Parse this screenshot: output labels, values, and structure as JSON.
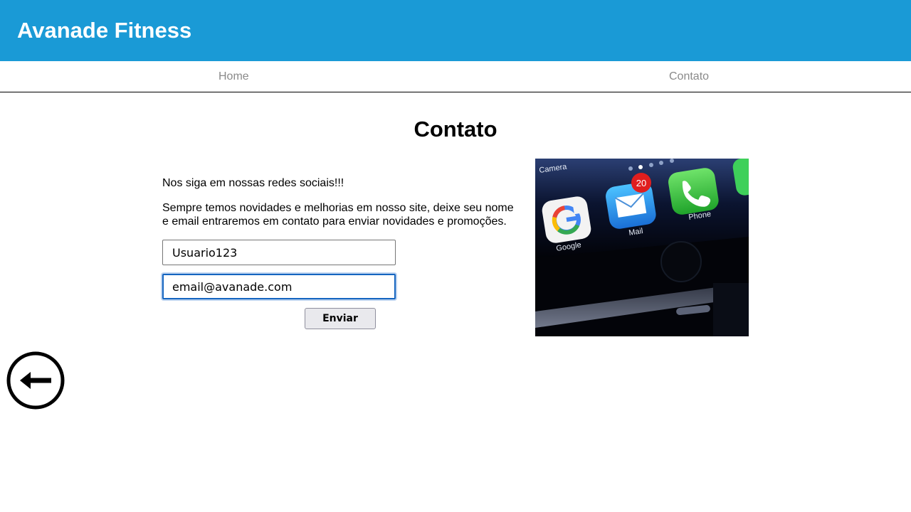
{
  "header": {
    "brand": "Avanade Fitness",
    "bg_color": "#1a9ad6"
  },
  "nav": {
    "items": [
      {
        "label": "Home"
      },
      {
        "label": "Contato"
      }
    ]
  },
  "main": {
    "title": "Contato",
    "intro": "Nos siga em nossas redes sociais!!!",
    "description": "Sempre temos novidades e melhorias em nosso site, deixe seu nome e email entraremos em contato para enviar novidades e promoções.",
    "form": {
      "name_value": "Usuario123",
      "email_value": "email@avanade.com",
      "submit_label": "Enviar"
    },
    "image": {
      "alt": "smartphone-home-screen",
      "labels": {
        "camera": "Camera",
        "google": "Google",
        "mail": "Mail",
        "phone": "Phone",
        "badge": "20"
      }
    }
  },
  "back_button": {
    "icon": "arrow-left-circle-icon"
  }
}
